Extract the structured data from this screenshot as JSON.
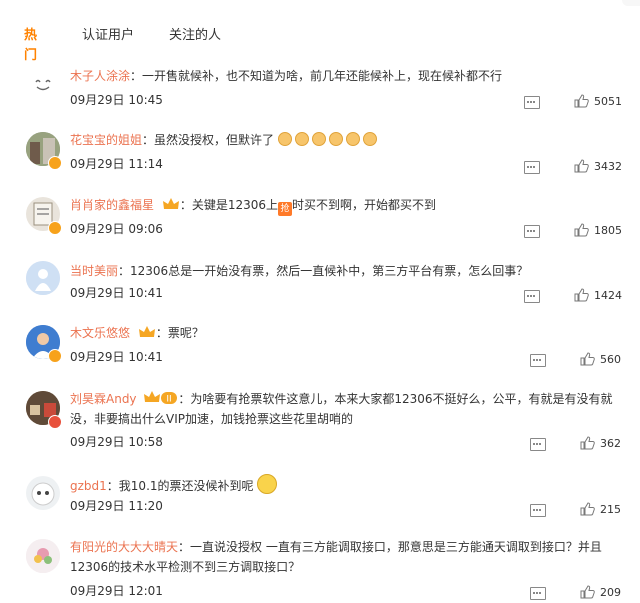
{
  "tabs": [
    {
      "label": "热门",
      "active": true
    },
    {
      "label": "认证用户",
      "active": false
    },
    {
      "label": "关注的人",
      "active": false
    }
  ],
  "colors": {
    "accent": "#ff8200",
    "username": "#eb7350"
  },
  "comments": [
    {
      "user": "木子人涂涂",
      "text": "：一开售就候补，也不知道为啥，前几年还能候补上，现在候补都不行",
      "time": "09月29日 10:45",
      "likes": "5051"
    },
    {
      "user": "花宝宝的姐姐",
      "text": "：虽然没授权，但默许了",
      "time": "09月29日 11:14",
      "likes": "3432"
    },
    {
      "user": "肖肖家的鑫福星",
      "text_before": "：关键是12306上",
      "tag": "抢",
      "text_after": "时买不到啊，开始都买不到",
      "time": "09月29日 09:06",
      "likes": "1805"
    },
    {
      "user": "当时美丽",
      "text": "：12306总是一开始没有票，然后一直候补中，第三方平台有票，怎么回事？",
      "time": "09月29日 10:41",
      "likes": "1424"
    },
    {
      "user": "木文乐悠悠",
      "text": "：票呢？",
      "time": "09月29日 10:41",
      "likes": "560"
    },
    {
      "user": "刘昊霖Andy",
      "text_l1": "：为啥要有抢票软件这意儿，本来大家都12306不挺好么，公平，有就是有没有就",
      "text_l2": "没，非要搞出什么VIP加速，加钱抢票这些花里胡哨的",
      "time": "09月29日 10:58",
      "likes": "362"
    },
    {
      "user": "gzbd1",
      "text": "：我10.1的票还没候补到呢",
      "time": "09月29日 11:20",
      "likes": "215"
    },
    {
      "user": "有阳光的大大大晴天",
      "text_l1": "：一直说没授权 一直有三方能调取接口，那意思是三方能通天调取到接口？并且",
      "text_l2": "12306的技术水平检测不到三方调取接口？",
      "time": "09月29日 12:01",
      "likes": "209"
    }
  ]
}
